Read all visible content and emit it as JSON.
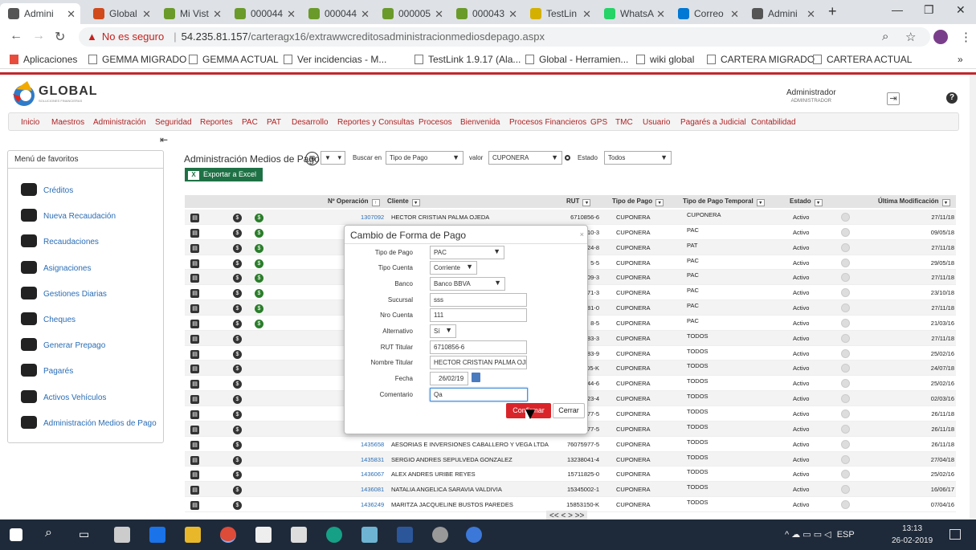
{
  "browser": {
    "tabs": [
      {
        "label": "Admini",
        "icon": "page-icon",
        "color": "#555555",
        "active": true
      },
      {
        "label": "Global",
        "icon": "global-icon",
        "color": "#d04a1c"
      },
      {
        "label": "Mi Vist",
        "icon": "gemma-icon",
        "color": "#6a9a2a"
      },
      {
        "label": "000044",
        "icon": "gemma-icon",
        "color": "#6a9a2a"
      },
      {
        "label": "000044",
        "icon": "gemma-icon",
        "color": "#6a9a2a"
      },
      {
        "label": "000005",
        "icon": "gemma-icon",
        "color": "#6a9a2a"
      },
      {
        "label": "000043",
        "icon": "gemma-icon",
        "color": "#6a9a2a"
      },
      {
        "label": "TestLin",
        "icon": "testlink-icon",
        "color": "#d4b000"
      },
      {
        "label": "WhatsA",
        "icon": "whatsapp-icon",
        "color": "#25d366"
      },
      {
        "label": "Correo",
        "icon": "outlook-icon",
        "color": "#0078d4"
      },
      {
        "label": "Admini",
        "icon": "page-icon",
        "color": "#555555"
      }
    ],
    "url_warning": "No es seguro",
    "url_host": "54.235.81.157",
    "url_path": "/carteragx16/extrawwcreditosadministracionmediosdepago.aspx",
    "bookmarks": [
      "Aplicaciones",
      "GEMMA MIGRADO",
      "GEMMA ACTUAL",
      "Ver incidencias - M...",
      "TestLink 1.9.17 (Ala...",
      "Global - Herramien...",
      "wiki global",
      "CARTERA MIGRADO",
      "CARTERA ACTUAL"
    ]
  },
  "app": {
    "logo_text": "GLOBAL",
    "logo_sub": "SOLUCIONES FINANCIERAS",
    "user_name": "Administrador",
    "user_role": "ADMINISTRADOR",
    "help": "?",
    "menu": [
      "Inicio",
      "Maestros",
      "Administración",
      "Seguridad",
      "Reportes",
      "PAC",
      "PAT",
      "Desarrollo",
      "Reportes y Consultas",
      "Procesos",
      "Bienvenida",
      "Procesos Financieros",
      "GPS",
      "TMC",
      "Usuario",
      "Pagarés a Judicial",
      "Contabilidad"
    ]
  },
  "sidebar": {
    "title": "Menú de favoritos",
    "items": [
      "Créditos",
      "Nueva Recaudación",
      "Recaudaciones",
      "Asignaciones",
      "Gestiones Diarias",
      "Cheques",
      "Generar Prepago",
      "Pagarés",
      "Activos Vehículos",
      "Administración Medios de Pago"
    ]
  },
  "toolbar": {
    "title": "Administración Medios de Pago",
    "buscar_label": "Buscar en",
    "buscar_value": "Tipo de Pago",
    "valor_label": "valor",
    "valor_value": "CUPONERA",
    "estado_label": "Estado",
    "estado_value": "Todos",
    "export_label": "Exportar a Excel"
  },
  "table": {
    "headers": {
      "operacion": "Nº Operación",
      "cliente": "Cliente",
      "rut": "RUT",
      "tipo": "Tipo de Pago",
      "tipo_temp": "Tipo de Pago Temporal",
      "estado": "Estado",
      "ultima": "Última Modificación"
    },
    "rows": [
      {
        "op": "1307092",
        "cliente": "HECTOR CRISTIAN PALMA OJEDA",
        "rut": "6710856-6",
        "tipo": "CUPONERA",
        "temp": "CUPONERA",
        "estado": "Activo",
        "fecha": "27/11/18",
        "green": true
      },
      {
        "op": "",
        "cliente": "",
        "rut": "10-3",
        "tipo": "CUPONERA",
        "temp": "PAC",
        "estado": "Activo",
        "fecha": "09/05/18",
        "green": true
      },
      {
        "op": "",
        "cliente": "",
        "rut": "24-8",
        "tipo": "CUPONERA",
        "temp": "PAT",
        "estado": "Activo",
        "fecha": "27/11/18",
        "green": true
      },
      {
        "op": "",
        "cliente": "",
        "rut": "5-5",
        "tipo": "CUPONERA",
        "temp": "PAC",
        "estado": "Activo",
        "fecha": "29/05/18",
        "green": true
      },
      {
        "op": "",
        "cliente": "",
        "rut": "09-3",
        "tipo": "CUPONERA",
        "temp": "PAC",
        "estado": "Activo",
        "fecha": "27/11/18",
        "green": true
      },
      {
        "op": "",
        "cliente": "",
        "rut": "71-3",
        "tipo": "CUPONERA",
        "temp": "PAC",
        "estado": "Activo",
        "fecha": "23/10/18",
        "green": true
      },
      {
        "op": "",
        "cliente": "",
        "rut": "81-0",
        "tipo": "CUPONERA",
        "temp": "PAC",
        "estado": "Activo",
        "fecha": "27/11/18",
        "green": true
      },
      {
        "op": "",
        "cliente": "",
        "rut": "8-5",
        "tipo": "CUPONERA",
        "temp": "PAC",
        "estado": "Activo",
        "fecha": "21/03/16",
        "green": true
      },
      {
        "op": "",
        "cliente": "",
        "rut": "83-3",
        "tipo": "CUPONERA",
        "temp": "TODOS",
        "estado": "Activo",
        "fecha": "27/11/18",
        "green": false
      },
      {
        "op": "",
        "cliente": "",
        "rut": "83-9",
        "tipo": "CUPONERA",
        "temp": "TODOS",
        "estado": "Activo",
        "fecha": "25/02/16",
        "green": false
      },
      {
        "op": "",
        "cliente": "",
        "rut": "05-K",
        "tipo": "CUPONERA",
        "temp": "TODOS",
        "estado": "Activo",
        "fecha": "24/07/18",
        "green": false
      },
      {
        "op": "",
        "cliente": "",
        "rut": "44-6",
        "tipo": "CUPONERA",
        "temp": "TODOS",
        "estado": "Activo",
        "fecha": "25/02/16",
        "green": false
      },
      {
        "op": "",
        "cliente": "",
        "rut": "23-4",
        "tipo": "CUPONERA",
        "temp": "TODOS",
        "estado": "Activo",
        "fecha": "02/03/16",
        "green": false
      },
      {
        "op": "",
        "cliente": "",
        "rut": "77-5",
        "tipo": "CUPONERA",
        "temp": "TODOS",
        "estado": "Activo",
        "fecha": "26/11/18",
        "green": false
      },
      {
        "op": "",
        "cliente": "",
        "rut": "77-5",
        "tipo": "CUPONERA",
        "temp": "TODOS",
        "estado": "Activo",
        "fecha": "26/11/18",
        "green": false
      },
      {
        "op": "1435658",
        "cliente": "AESORIAS E INVERSIONES CABALLERO Y VEGA LTDA",
        "rut": "76075977-5",
        "tipo": "CUPONERA",
        "temp": "TODOS",
        "estado": "Activo",
        "fecha": "26/11/18",
        "green": false
      },
      {
        "op": "1435831",
        "cliente": "SERGIO ANDRES SEPULVEDA GONZALEZ",
        "rut": "13238041-4",
        "tipo": "CUPONERA",
        "temp": "TODOS",
        "estado": "Activo",
        "fecha": "27/04/18",
        "green": false
      },
      {
        "op": "1436067",
        "cliente": "ALEX ANDRES URIBE REYES",
        "rut": "15711825-0",
        "tipo": "CUPONERA",
        "temp": "TODOS",
        "estado": "Activo",
        "fecha": "25/02/16",
        "green": false
      },
      {
        "op": "1436081",
        "cliente": "NATALIA ANGELICA SARAVIA VALDIVIA",
        "rut": "15345002-1",
        "tipo": "CUPONERA",
        "temp": "TODOS",
        "estado": "Activo",
        "fecha": "16/06/17",
        "green": false
      },
      {
        "op": "1436249",
        "cliente": "MARITZA JACQUELINE BUSTOS PAREDES",
        "rut": "15853150-K",
        "tipo": "CUPONERA",
        "temp": "TODOS",
        "estado": "Activo",
        "fecha": "07/04/16",
        "green": false
      }
    ],
    "pager": "<< < > >>"
  },
  "modal": {
    "title": "Cambio de Forma de Pago",
    "close": "×",
    "fields": {
      "tipo_pago": {
        "label": "Tipo de Pago",
        "value": "PAC"
      },
      "tipo_cuenta": {
        "label": "Tipo Cuenta",
        "value": "Corriente"
      },
      "banco": {
        "label": "Banco",
        "value": "Banco BBVA"
      },
      "sucursal": {
        "label": "Sucursal",
        "value": "sss"
      },
      "nro_cuenta": {
        "label": "Nro Cuenta",
        "value": "111"
      },
      "alternativo": {
        "label": "Alternativo",
        "value": "Sí"
      },
      "rut_titular": {
        "label": "RUT Titular",
        "value": "6710856-6"
      },
      "nombre_titular": {
        "label": "Nombre Titular",
        "value": "HECTOR CRISTIAN PALMA OJEDA"
      },
      "fecha": {
        "label": "Fecha",
        "value": "26/02/19"
      },
      "comentario": {
        "label": "Comentario",
        "value": "Qa"
      }
    },
    "confirm": "Confirmar",
    "cancel": "Cerrar",
    "confirm_color": "#d9252a"
  },
  "taskbar": {
    "lang": "ESP",
    "time": "13:13",
    "date": "26-02-2019"
  }
}
